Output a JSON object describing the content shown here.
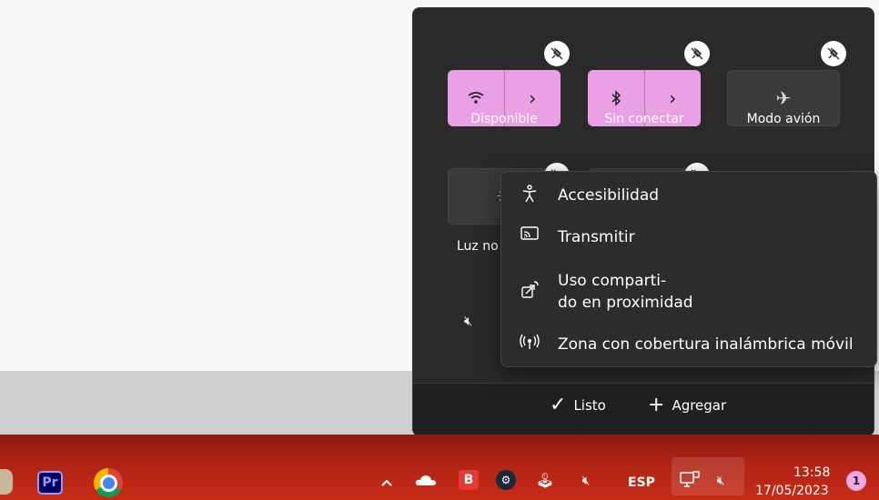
{
  "quick_settings": {
    "tiles": [
      {
        "label": "Disponible",
        "state": "on",
        "icons": [
          "wifi-icon",
          "chevron-right-icon"
        ]
      },
      {
        "label": "Sin conectar",
        "state": "on",
        "icons": [
          "bluetooth-icon",
          "chevron-right-icon"
        ]
      },
      {
        "label": "Modo avión",
        "state": "off",
        "icons": [
          "airplane-icon"
        ]
      },
      {
        "label": "Luz no",
        "state": "off",
        "icons": [
          "brightness-icon"
        ]
      }
    ],
    "pin_icon": "unpin-icon",
    "volume_icon": "volume-muted-icon",
    "footer": {
      "done_label": "Listo",
      "add_label": "Agregar"
    }
  },
  "context_menu": {
    "items": [
      {
        "icon": "accessibility-icon",
        "label": "Accesibilidad"
      },
      {
        "icon": "cast-icon",
        "label": "Transmitir"
      },
      {
        "icon": "nearby-share-icon",
        "label": "Uso comparti-\ndo en proximidad"
      },
      {
        "icon": "mobile-hotspot-icon",
        "label": "Zona con cobertura inalámbrica móvil"
      }
    ]
  },
  "taskbar": {
    "apps": [
      {
        "name": "Premiere Pro",
        "icon": "premiere-icon",
        "text": "Pr"
      },
      {
        "name": "Chrome",
        "icon": "chrome-icon"
      }
    ],
    "tray": {
      "language": "ESP",
      "time": "13:58",
      "date": "17/05/2023",
      "notification_count": "1"
    }
  },
  "colors": {
    "tile_active": "#e9a0e4",
    "panel_bg": "#2a2a2a",
    "taskbar": "#b02414"
  }
}
